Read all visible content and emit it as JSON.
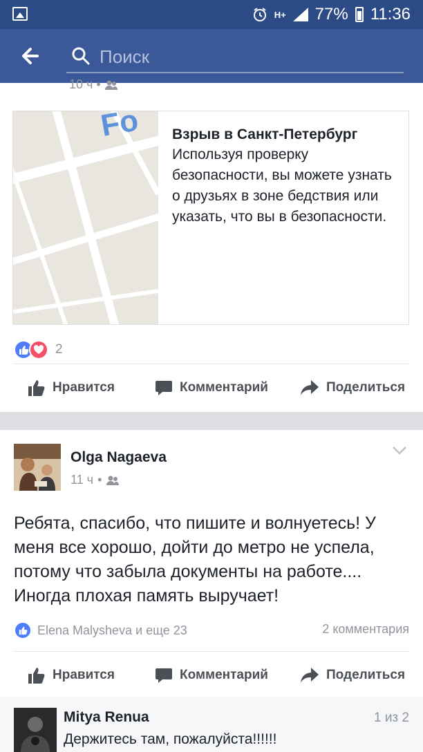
{
  "status_bar": {
    "battery": "77%",
    "time": "11:36",
    "network": "H+"
  },
  "search": {
    "placeholder": "Поиск"
  },
  "first_post": {
    "time": "10 ч",
    "card": {
      "title": "Взрыв в Санкт-Петербург",
      "description": "Используя проверку безопасности, вы можете узнать о друзьях в зоне бедствия или указать, что вы в безопасности."
    },
    "reactions_count": "2"
  },
  "actions": {
    "like": "Нравится",
    "comment": "Комментарий",
    "share": "Поделиться"
  },
  "second_post": {
    "author": "Olga Nagaeva",
    "time": "11 ч",
    "text": "Ребята, спасибо, что пишите и волнуетесь! У меня все хорошо, дойти до метро не успела, потому что забыла документы на  работе.... Иногда плохая память выручает!",
    "likes_text": "Elena Malysheva и еще 23",
    "comments_text": "2 комментария"
  },
  "comment": {
    "author": "Mitya Renua",
    "pager": "1 из 2",
    "text": "Держитесь там, пожалуйста!!!!!!"
  },
  "colors": {
    "header_bg": "#3b5998",
    "status_bg": "#2c4a86",
    "like_blue": "#4f7df9",
    "love_red": "#f25268"
  }
}
